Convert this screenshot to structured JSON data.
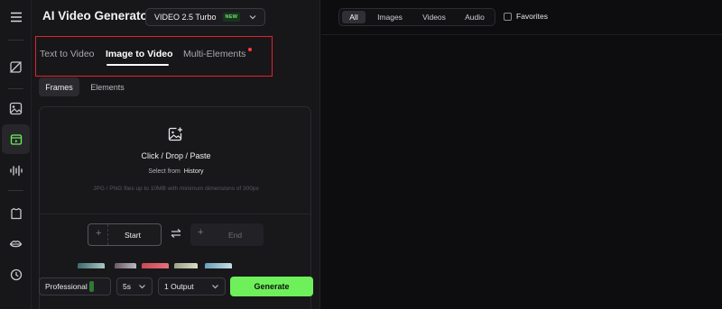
{
  "app": {
    "title": "AI Video Generator",
    "model": {
      "name": "VIDEO 2.5 Turbo",
      "badge": "NEW"
    }
  },
  "rail": {
    "icons": [
      "menu-icon",
      "no-image-icon",
      "image-icon",
      "video-icon",
      "audio-wave-icon",
      "shirt-icon",
      "lips-icon",
      "history-icon"
    ]
  },
  "mode_tabs": {
    "items": [
      "Text to Video",
      "Image to Video",
      "Multi-Elements"
    ],
    "active": "Image to Video",
    "highlight_color": "#e0222a"
  },
  "sub_tabs": {
    "items": [
      "Frames",
      "Elements"
    ],
    "active": "Frames"
  },
  "upload": {
    "action_text": "Click / Drop / Paste",
    "select_prefix": "Select from",
    "select_link": "History",
    "hint": "JPG / PNG files up to 10MB with minimum dimensions of 300px"
  },
  "frames": {
    "start_label": "Start",
    "end_label": "End"
  },
  "settings": {
    "mode": "Professional",
    "duration": "5s",
    "outputs": "1 Output",
    "generate_label": "Generate",
    "generate_color": "#6ef05a"
  },
  "gallery": {
    "filters": [
      "All",
      "Images",
      "Videos",
      "Audio"
    ],
    "active_filter": "All",
    "favorites_label": "Favorites"
  }
}
